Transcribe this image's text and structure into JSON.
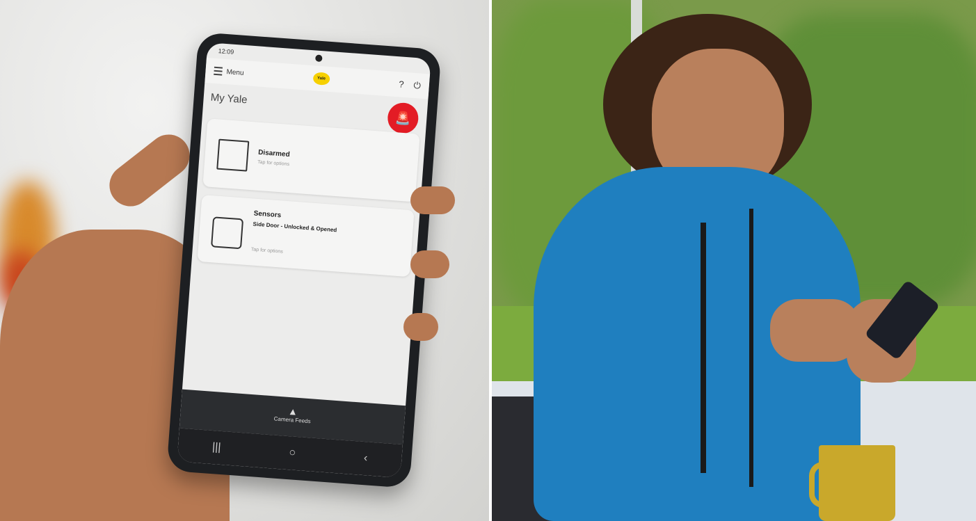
{
  "status_bar": {
    "time": "12:09"
  },
  "app": {
    "menu_label": "Menu",
    "logo_text": "Yale",
    "help_icon": "?",
    "power_icon": "⏻",
    "title": "My Yale",
    "alarm_icon": "🚨",
    "cards": [
      {
        "title": "Disarmed",
        "subtitle": "Tap for options"
      },
      {
        "title": "Sensors",
        "detail": "Side Door - Unlocked & Opened",
        "subtitle": "Tap for options"
      }
    ],
    "bottom_nav_label": "Camera Feeds",
    "system_nav": [
      "|||",
      "○",
      "‹"
    ]
  },
  "colors": {
    "alarm_red": "#e31c25",
    "yale_yellow": "#f6d000",
    "hoodie_blue": "#1f7fbf",
    "mug_yellow": "#c9a82b"
  }
}
